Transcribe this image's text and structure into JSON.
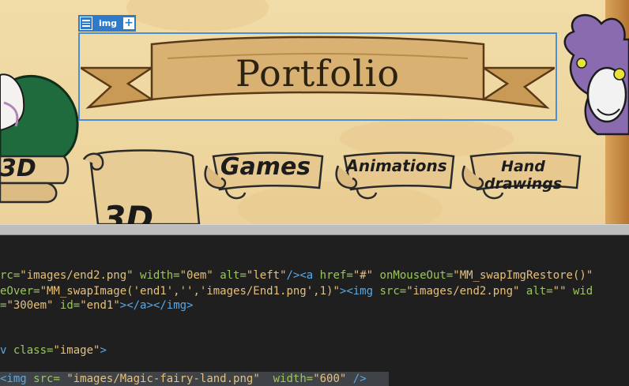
{
  "design": {
    "toolbar": {
      "tag_label": "img",
      "add_label": "+"
    },
    "banner": {
      "title": "Portfolio"
    },
    "nav": [
      {
        "label": "3D"
      },
      {
        "label": "Games"
      },
      {
        "label": "Animations"
      },
      {
        "label": "Hand drawings"
      }
    ],
    "preview_fragment": "3D"
  },
  "code": {
    "lines": [
      [
        {
          "t": "rc=",
          "c": "attr"
        },
        {
          "t": "\"images/end2.png\"",
          "c": "val"
        },
        {
          "t": " "
        },
        {
          "t": "width=",
          "c": "attr"
        },
        {
          "t": "\"0em\"",
          "c": "val"
        },
        {
          "t": " "
        },
        {
          "t": "alt=",
          "c": "attr"
        },
        {
          "t": "\"left\"",
          "c": "val"
        },
        {
          "t": "/>",
          "c": "tagc"
        },
        {
          "t": "<a",
          "c": "tagc"
        },
        {
          "t": " "
        },
        {
          "t": "href=",
          "c": "attr"
        },
        {
          "t": "\"#\"",
          "c": "val"
        },
        {
          "t": " "
        },
        {
          "t": "onMouseOut=",
          "c": "attr"
        },
        {
          "t": "\"MM_swapImgRestore()\"",
          "c": "val"
        }
      ],
      [
        {
          "t": "eOver=",
          "c": "attr"
        },
        {
          "t": "\"MM_swapImage('end1','','images/End1.png',1)\"",
          "c": "val"
        },
        {
          "t": ">",
          "c": "tagc"
        },
        {
          "t": "<img",
          "c": "tagc"
        },
        {
          "t": " "
        },
        {
          "t": "src=",
          "c": "attr"
        },
        {
          "t": "\"images/end2.png\"",
          "c": "val"
        },
        {
          "t": " "
        },
        {
          "t": "alt=",
          "c": "attr"
        },
        {
          "t": "\"\"",
          "c": "val"
        },
        {
          "t": " "
        },
        {
          "t": "wid",
          "c": "attr"
        }
      ],
      [
        {
          "t": "=",
          "c": "attr"
        },
        {
          "t": "\"300em\"",
          "c": "val"
        },
        {
          "t": " "
        },
        {
          "t": "id=",
          "c": "attr"
        },
        {
          "t": "\"end1\"",
          "c": "val"
        },
        {
          "t": "></a></img>",
          "c": "tagc"
        }
      ],
      [],
      [],
      [
        {
          "t": "v",
          "c": "tagc"
        },
        {
          "t": " "
        },
        {
          "t": "class=",
          "c": "attr"
        },
        {
          "t": "\"image\"",
          "c": "val"
        },
        {
          "t": ">",
          "c": "tagc"
        }
      ],
      [],
      [
        {
          "t": "<img",
          "c": "tagc"
        },
        {
          "t": " "
        },
        {
          "t": "src=",
          "c": "attr"
        },
        {
          "t": " "
        },
        {
          "t": "\"images/Magic-fairy-land.png\"",
          "c": "val"
        },
        {
          "t": "  "
        },
        {
          "t": "width=",
          "c": "attr"
        },
        {
          "t": "\"600\"",
          "c": "val"
        },
        {
          "t": " "
        },
        {
          "t": "/>",
          "c": "tagc"
        }
      ]
    ]
  },
  "colors": {
    "selection": "#4a90d9",
    "toolbar": "#2f7bc9",
    "code_bg": "#1f1f1f",
    "attr": "#9bc65d",
    "value": "#e5c07b",
    "tag": "#5aa9e6"
  }
}
